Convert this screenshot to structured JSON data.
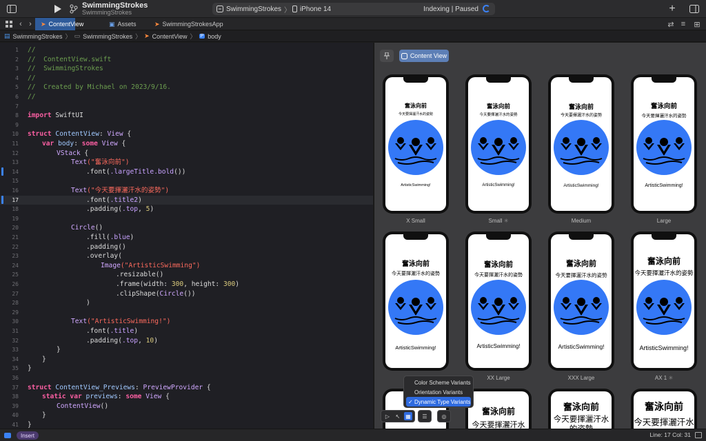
{
  "toolbar": {
    "project_name": "SwimmingStrokes",
    "project_sub": "SwimmingStrokes",
    "scheme_target": "SwimmingStrokes",
    "scheme_device": "iPhone 14",
    "status": "Indexing | Paused",
    "add_label": "+"
  },
  "tabs": [
    {
      "label": "ContentView"
    },
    {
      "label": "Assets"
    },
    {
      "label": "SwimmingStrokesApp"
    }
  ],
  "breadcrumb": [
    "SwimmingStrokes",
    "SwimmingStrokes",
    "ContentView",
    "body"
  ],
  "editor": {
    "lines": [
      {
        "n": "1"
      },
      {
        "n": "2"
      },
      {
        "n": "3"
      },
      {
        "n": "4"
      },
      {
        "n": "5"
      },
      {
        "n": "6"
      },
      {
        "n": "7"
      },
      {
        "n": "8"
      },
      {
        "n": "9"
      },
      {
        "n": "10"
      },
      {
        "n": "11"
      },
      {
        "n": "12"
      },
      {
        "n": "13"
      },
      {
        "n": "14"
      },
      {
        "n": "15"
      },
      {
        "n": "16"
      },
      {
        "n": "17"
      },
      {
        "n": "18"
      },
      {
        "n": "19"
      },
      {
        "n": "20"
      },
      {
        "n": "21"
      },
      {
        "n": "22"
      },
      {
        "n": "23"
      },
      {
        "n": "24"
      },
      {
        "n": "25"
      },
      {
        "n": "26"
      },
      {
        "n": "27"
      },
      {
        "n": "28"
      },
      {
        "n": "29"
      },
      {
        "n": "30"
      },
      {
        "n": "31"
      },
      {
        "n": "32"
      },
      {
        "n": "33"
      },
      {
        "n": "34"
      },
      {
        "n": "35"
      },
      {
        "n": "36"
      },
      {
        "n": "37"
      },
      {
        "n": "38"
      },
      {
        "n": "39"
      },
      {
        "n": "40"
      },
      {
        "n": "41"
      }
    ],
    "code": {
      "l1": "//",
      "l2": "//  ContentView.swift",
      "l3": "//  SwimmingStrokes",
      "l4": "//",
      "l5": "//  Created by Michael on 2023/9/16.",
      "l6": "//",
      "l8_kw": "import",
      "l8_rest": " SwiftUI",
      "l10_kw": "struct",
      "l10_name": " ContentView",
      "l10_colon": ": ",
      "l10_type": "View",
      "l10_brace": " {",
      "l11_kw": "var",
      "l11_name": " body",
      "l11_colon": ": ",
      "l11_kw2": "some",
      "l11_type": " View",
      "l11_brace": " {",
      "l12_type": "VStack",
      "l12_brace": " {",
      "l13_type": "Text",
      "l13_str": "(\"奮泳向前\")",
      "l14_a": ".font(",
      "l14_b": ".largeTitle.bold",
      "l14_c": "())",
      "l16_type": "Text",
      "l16_str": "(\"今天要揮灑汗水的姿勢\")",
      "l17_a": ".font(",
      "l17_b": ".title2",
      "l17_c": ")",
      "l18_a": ".padding(",
      "l18_b": ".top",
      "l18_c": ", ",
      "l18_num": "5",
      "l18_d": ")",
      "l20_type": "Circle",
      "l20_rest": "()",
      "l21_a": ".fill(",
      "l21_b": ".blue",
      "l21_c": ")",
      "l22": ".padding()",
      "l23": ".overlay(",
      "l24_type": "Image",
      "l24_str": "(\"ArtisticSwimming\")",
      "l25": ".resizable()",
      "l26_a": ".frame(width: ",
      "l26_n1": "300",
      "l26_b": ", height: ",
      "l26_n2": "300",
      "l26_c": ")",
      "l27_a": ".clipShape(",
      "l27_type": "Circle",
      "l27_c": "())",
      "l28": ")",
      "l30_type": "Text",
      "l30_str": "(\"ArtisticSwimming!\")",
      "l31_a": ".font(",
      "l31_b": ".title",
      "l31_c": ")",
      "l32_a": ".padding(",
      "l32_b": ".top",
      "l32_c": ", ",
      "l32_num": "10",
      "l32_d": ")",
      "l33": "}",
      "l34": "}",
      "l35": "}",
      "l37_kw": "struct",
      "l37_name": " ContentView_Previews",
      "l37_colon": ": ",
      "l37_type": "PreviewProvider",
      "l37_brace": " {",
      "l38_kw": "static",
      "l38_kw2": " var",
      "l38_name": " previews",
      "l38_colon": ": ",
      "l38_kw3": "some",
      "l38_type": " View",
      "l38_brace": " {",
      "l39_type": "ContentView",
      "l39_rest": "()",
      "l40": "}",
      "l41": "}"
    }
  },
  "canvas": {
    "content_view_label": "Content View",
    "preview_title": "奮泳向前",
    "preview_sub": "今天要揮灑汗水的姿勢",
    "preview_sub_wrapped": "今天要揮灑汗水",
    "preview_sub_wrap2": "的姿勢",
    "preview_footer": "ArtisticSwimming!",
    "variants": [
      "X Small",
      "Small",
      "Medium",
      "Large",
      "",
      "XX Large",
      "XXX Large",
      "AX 1"
    ]
  },
  "menu": {
    "items": [
      "Color Scheme Variants",
      "Orientation Variants",
      "Dynamic Type Variants"
    ],
    "selected": "Dynamic Type Variants",
    "checkmark": "✓"
  },
  "statusbar": {
    "mode": "Insert",
    "position": "Line: 17  Col: 31"
  },
  "colors": {
    "accent": "#3b82f6",
    "circle": "#3478f6",
    "menu_selected": "#2f6be0"
  }
}
